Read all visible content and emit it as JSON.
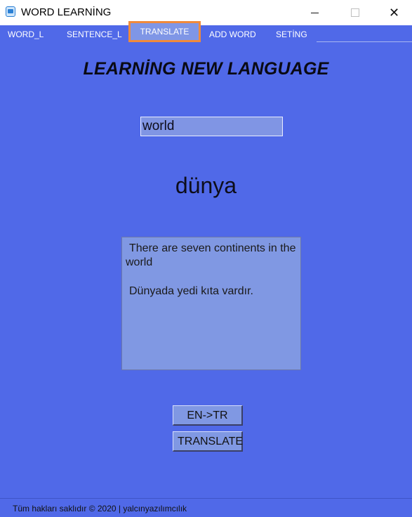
{
  "window": {
    "title": "WORD LEARNİNG",
    "icon": "app-icon",
    "controls": {
      "minimize": "minimize-icon",
      "maximize": "maximize-icon",
      "close": "close-icon"
    }
  },
  "menu": {
    "items": [
      {
        "label": "WORD_L"
      },
      {
        "label": "SENTENCE_L"
      },
      {
        "label": "TRANSLATE",
        "active": true
      },
      {
        "label": "ADD WORD"
      },
      {
        "label": "SETİNG"
      }
    ]
  },
  "main": {
    "heading": "LEARNİNG NEW LANGUAGE",
    "input_value": "world",
    "translation": "dünya",
    "sentence_en": "There are seven continents in the world",
    "sentence_tr": "Dünyada yedi kıta vardır.",
    "direction_button": "EN->TR",
    "translate_button": "TRANSLATE"
  },
  "footer": {
    "text": "Tüm hakları saklıdır © 2020 | yalcınyazılımcılık"
  },
  "colors": {
    "background": "#5069e8",
    "active_tab_highlight": "#f08a3c",
    "panel": "#8098e3"
  }
}
